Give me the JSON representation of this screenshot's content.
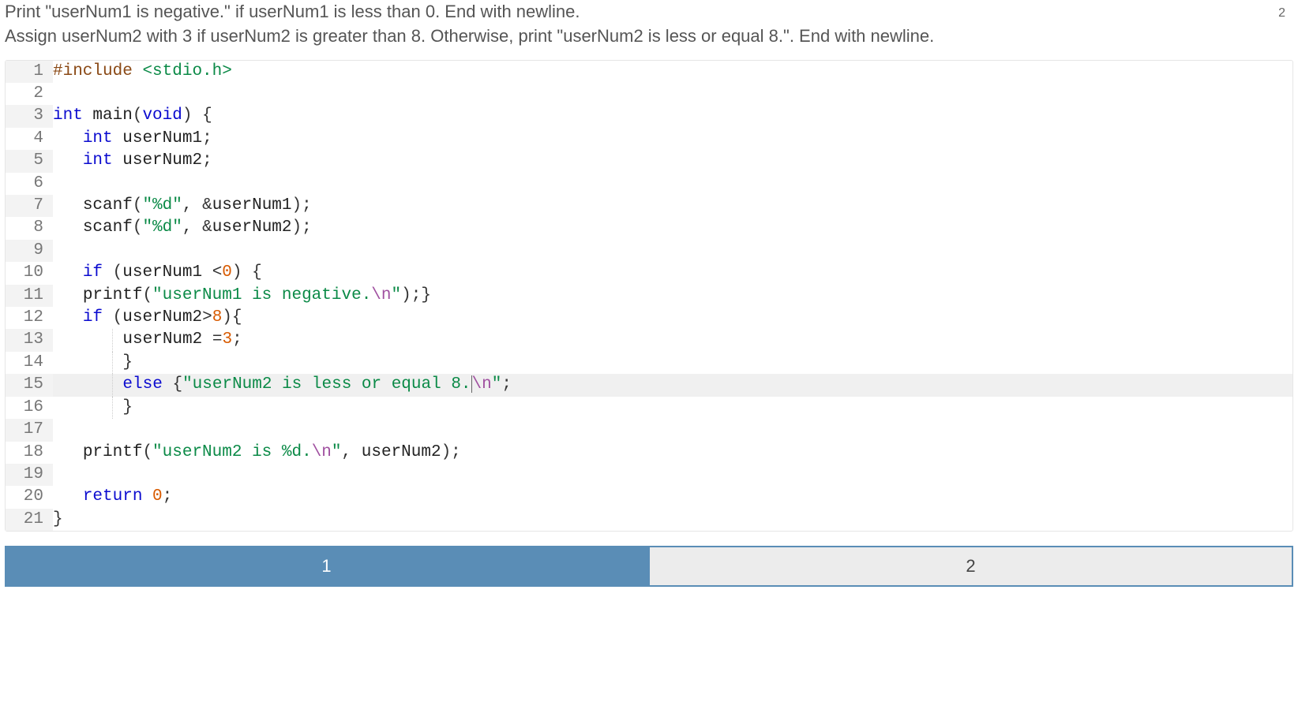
{
  "problem": {
    "line1": "Print \"userNum1 is negative.\" if userNum1 is less than 0. End with newline.",
    "line2": "Assign userNum2 with 3 if userNum2 is greater than 8. Otherwise, print \"userNum2 is less or equal 8.\". End with newline."
  },
  "badge_text": "2",
  "code": {
    "l1": {
      "num": "1",
      "pre": "#include",
      "angle": "<stdio.h>"
    },
    "l2": {
      "num": "2"
    },
    "l3": {
      "num": "3",
      "kw1": "int",
      "id1": "main",
      "kw2": "void",
      "brace": "{"
    },
    "l4": {
      "num": "4",
      "kw": "int",
      "id": "userNum1"
    },
    "l5": {
      "num": "5",
      "kw": "int",
      "id": "userNum2"
    },
    "l6": {
      "num": "6"
    },
    "l7": {
      "num": "7",
      "id": "scanf",
      "str": "\"%d\"",
      "arg": "&userNum1"
    },
    "l8": {
      "num": "8",
      "id": "scanf",
      "str": "\"%d\"",
      "arg": "&userNum2"
    },
    "l9": {
      "num": "9"
    },
    "l10": {
      "num": "10",
      "kw": "if",
      "id": "userNum1",
      "num0": "0"
    },
    "l11": {
      "num": "11",
      "id": "printf",
      "str": "\"userNum1 is negative.",
      "esc": "\\n",
      "strend": "\""
    },
    "l12": {
      "num": "12",
      "kw": "if",
      "id": "userNum2",
      "num8": "8"
    },
    "l13": {
      "num": "13",
      "id": "userNum2",
      "num3": "3"
    },
    "l14": {
      "num": "14"
    },
    "l15": {
      "num": "15",
      "kw": "else",
      "str": "\"userNum2 is less or equal 8.",
      "esc": "\\n",
      "strend": "\""
    },
    "l16": {
      "num": "16"
    },
    "l17": {
      "num": "17"
    },
    "l18": {
      "num": "18",
      "id": "printf",
      "str": "\"userNum2 is %d.",
      "esc": "\\n",
      "strend": "\"",
      "arg": "userNum2"
    },
    "l19": {
      "num": "19"
    },
    "l20": {
      "num": "20",
      "kw": "return",
      "n": "0"
    },
    "l21": {
      "num": "21"
    }
  },
  "tabs": {
    "t1": "1",
    "t2": "2"
  }
}
